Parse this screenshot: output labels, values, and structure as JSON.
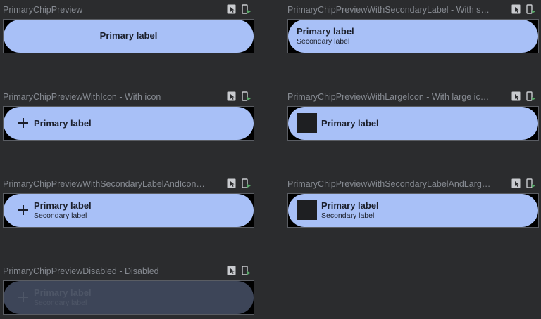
{
  "colors": {
    "background": "#2b2c2e",
    "chip": "#a8c0f7",
    "chip_disabled": "#3d4558",
    "chip_text": "#1b1f2b",
    "deploy_accent": "#59a869"
  },
  "previews": [
    {
      "title": "PrimaryChipPreview",
      "primary_label": "Primary label"
    },
    {
      "title": "PrimaryChipPreviewWithSecondaryLabel - With s…",
      "primary_label": "Primary label",
      "secondary_label": "Secondary label"
    },
    {
      "title": "PrimaryChipPreviewWithIcon - With icon",
      "primary_label": "Primary label",
      "icon": "plus-icon"
    },
    {
      "title": "PrimaryChipPreviewWithLargeIcon - With large ic…",
      "primary_label": "Primary label",
      "icon": "large-square-icon"
    },
    {
      "title": "PrimaryChipPreviewWithSecondaryLabelAndIcon…",
      "primary_label": "Primary label",
      "secondary_label": "Secondary label",
      "icon": "plus-icon"
    },
    {
      "title": "PrimaryChipPreviewWithSecondaryLabelAndLarg…",
      "primary_label": "Primary label",
      "secondary_label": "Secondary label",
      "icon": "large-square-icon"
    },
    {
      "title": "PrimaryChipPreviewDisabled - Disabled",
      "primary_label": "Primary label",
      "secondary_label": "Secondary label",
      "icon": "plus-icon",
      "disabled": true
    }
  ],
  "header_icons": [
    "interactive-mode-icon",
    "deploy-preview-icon"
  ]
}
